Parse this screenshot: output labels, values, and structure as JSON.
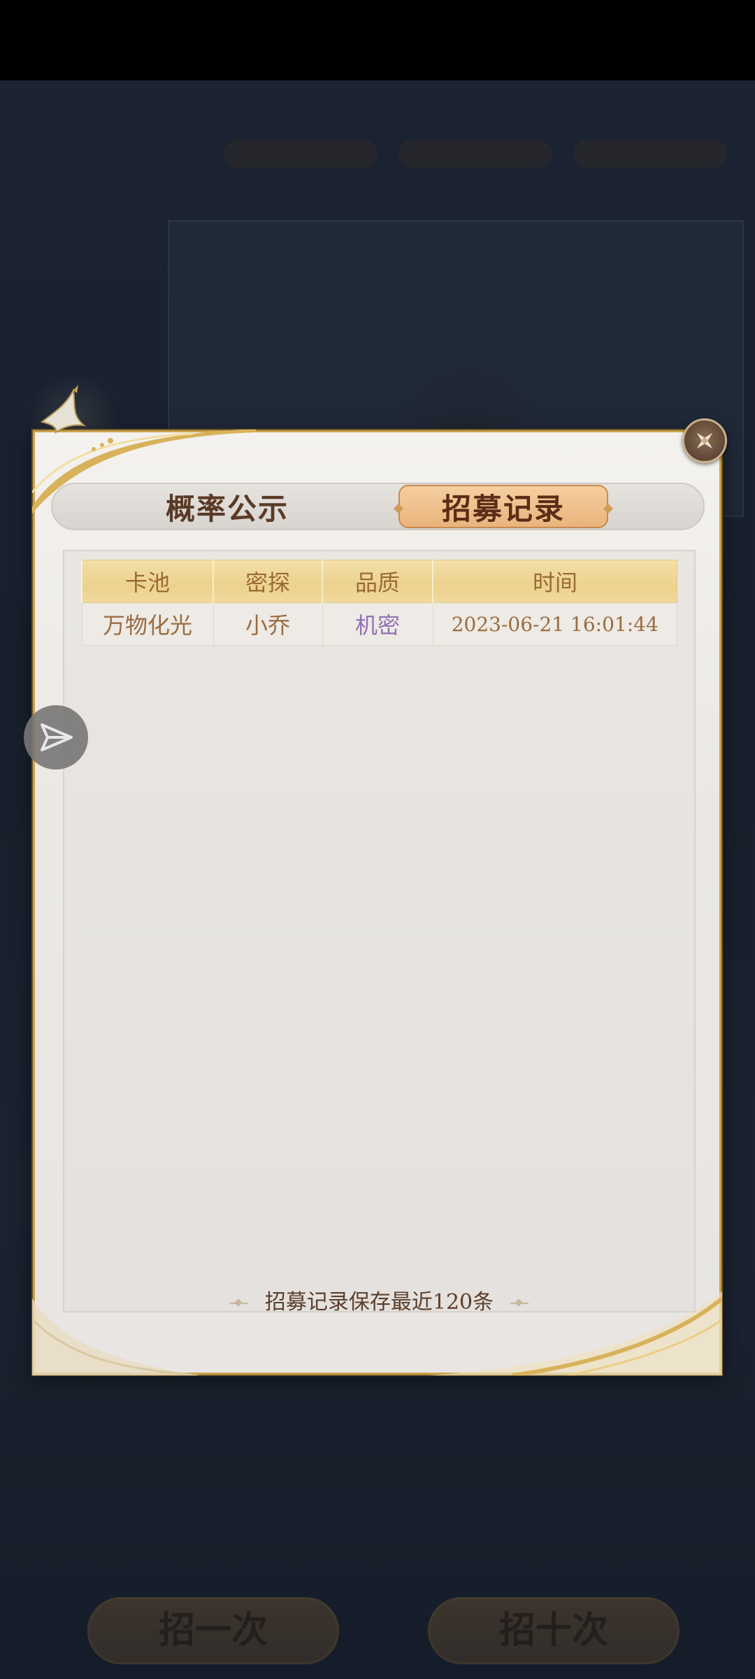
{
  "tabs": {
    "probability_label": "概率公示",
    "records_label": "招募记录"
  },
  "table": {
    "headers": [
      "卡池",
      "密探",
      "品质",
      "时间"
    ],
    "rows": [
      {
        "pool": "万物化光",
        "agent": "小乔",
        "quality": "机密",
        "time": "2023-06-21 16:01:44"
      }
    ]
  },
  "footer": {
    "note": "招募记录保存最近120条"
  },
  "background_buttons": {
    "single": "招一次",
    "ten": "招十次"
  },
  "icons": {
    "close": "close-icon",
    "share": "share-arrow-icon",
    "bird": "bird-ornament-icon"
  },
  "colors": {
    "accent_gold": "#c9a24b",
    "active_tab": "#e9b47c",
    "quality_purple": "#9270b8"
  }
}
